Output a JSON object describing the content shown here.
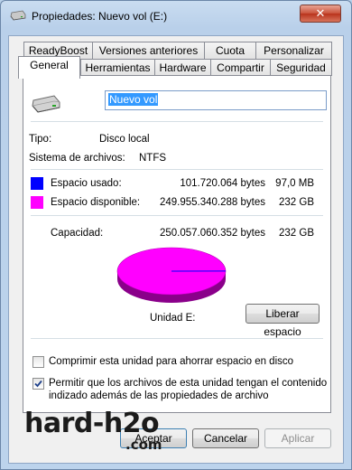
{
  "window": {
    "title": "Propiedades: Nuevo vol (E:)",
    "close_label": "✕",
    "icon": "drive-icon"
  },
  "tabs_back": [
    {
      "label": "ReadyBoost"
    },
    {
      "label": "Versiones anteriores"
    },
    {
      "label": "Cuota"
    },
    {
      "label": "Personalizar"
    }
  ],
  "tabs_front": [
    {
      "label": "General",
      "active": true
    },
    {
      "label": "Herramientas"
    },
    {
      "label": "Hardware"
    },
    {
      "label": "Compartir"
    },
    {
      "label": "Seguridad"
    }
  ],
  "general": {
    "volume_name": "Nuevo vol",
    "type_label": "Tipo:",
    "type_value": "Disco local",
    "fs_label": "Sistema de archivos:",
    "fs_value": "NTFS",
    "used_label": "Espacio usado:",
    "used_bytes": "101.720.064 bytes",
    "used_size": "97,0 MB",
    "free_label": "Espacio disponible:",
    "free_bytes": "249.955.340.288 bytes",
    "free_size": "232 GB",
    "capacity_label": "Capacidad:",
    "capacity_bytes": "250.057.060.352 bytes",
    "capacity_size": "232 GB",
    "drive_label": "Unidad E:",
    "cleanup_button": "Liberar espacio",
    "compress_label": "Comprimir esta unidad para ahorrar espacio en disco",
    "compress_checked": false,
    "index_label_line1": "Permitir que los archivos de esta unidad tengan el contenido",
    "index_label_line2": "indizado además de las propiedades de archivo",
    "index_checked": true,
    "used_color": "#0000ff",
    "free_color": "#ff00ff",
    "used_fraction": 0.0004
  },
  "footer": {
    "accept_button": "Aceptar",
    "cancel_button": "Cancelar",
    "apply_button": "Aplicar"
  },
  "watermark": {
    "text": "hard-h2o",
    "sub": ".com"
  }
}
